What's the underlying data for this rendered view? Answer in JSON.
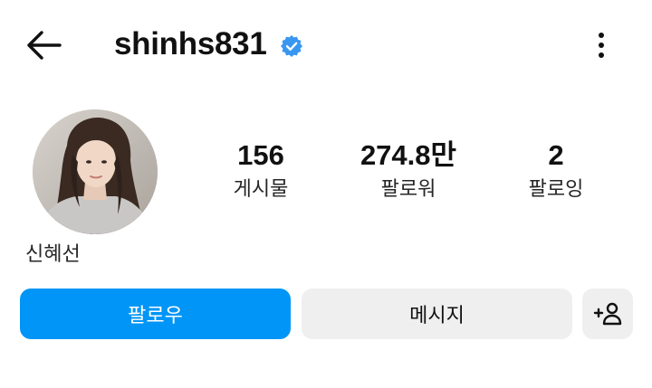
{
  "header": {
    "username": "shinhs831",
    "verified_icon": "verified-badge-icon",
    "back_icon": "arrow-left-icon",
    "more_icon": "more-vertical-icon"
  },
  "profile": {
    "full_name": "신혜선",
    "avatar_icon": "profile-photo"
  },
  "stats": {
    "posts_count": "156",
    "posts_label": "게시물",
    "followers_count": "274.8만",
    "followers_label": "팔로워",
    "following_count": "2",
    "following_label": "팔로잉"
  },
  "actions": {
    "follow_label": "팔로우",
    "message_label": "메시지",
    "add_user_icon": "add-user-icon"
  },
  "colors": {
    "accent": "#0095f6",
    "secondary_button": "#efefef",
    "verified": "#3897f0"
  }
}
